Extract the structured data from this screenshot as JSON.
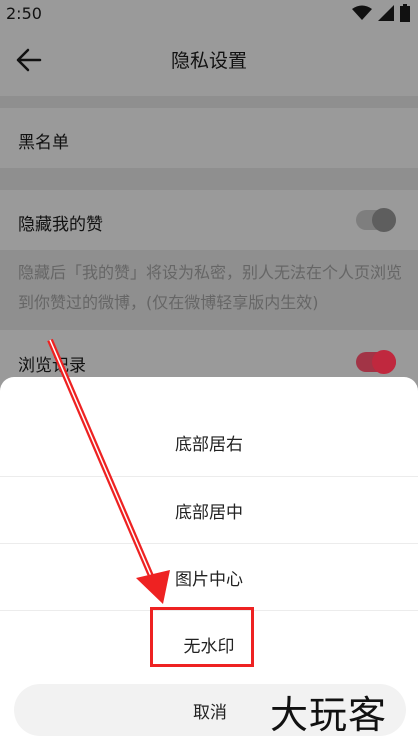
{
  "status_bar": {
    "time": "2:50"
  },
  "header": {
    "title": "隐私设置"
  },
  "settings": {
    "blacklist_label": "黑名单",
    "hide_likes_label": "隐藏我的赞",
    "hide_likes_on": false,
    "hide_likes_desc": "隐藏后「我的赞」将设为私密，别人无法在个人页浏览到你赞过的微博，(仅在微博轻享版内生效)",
    "browse_history_label": "浏览记录",
    "browse_history_on": true
  },
  "sheet": {
    "options": [
      "底部居右",
      "底部居中",
      "图片中心",
      "无水印"
    ],
    "cancel_label": "取消"
  },
  "watermark": {
    "text": "大玩客"
  },
  "colors": {
    "dim_background": "#9a9a9a",
    "toggle_on": "#c0283e",
    "toggle_off": "#6e6e6e",
    "annotation_red": "#e22222"
  }
}
